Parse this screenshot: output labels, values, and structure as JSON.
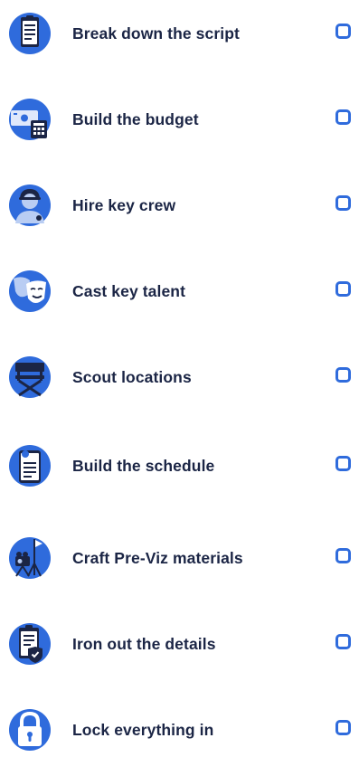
{
  "checklist": {
    "items": [
      {
        "label": "Break down the script",
        "icon": "script-clipboard-icon",
        "checked": false
      },
      {
        "label": "Build the budget",
        "icon": "budget-calculator-icon",
        "checked": false
      },
      {
        "label": "Hire key crew",
        "icon": "crew-person-icon",
        "checked": false
      },
      {
        "label": "Cast key talent",
        "icon": "theater-masks-icon",
        "checked": false
      },
      {
        "label": "Scout locations",
        "icon": "director-chair-icon",
        "checked": false
      },
      {
        "label": "Build the schedule",
        "icon": "schedule-document-icon",
        "checked": false
      },
      {
        "label": "Craft Pre-Viz materials",
        "icon": "camera-tripod-icon",
        "checked": false
      },
      {
        "label": "Iron out the details",
        "icon": "details-clipboard-shield-icon",
        "checked": false
      },
      {
        "label": "Lock everything in",
        "icon": "padlock-icon",
        "checked": false
      }
    ]
  },
  "colors": {
    "icon_circle": "#2f6bdc",
    "icon_dark": "#1b2545",
    "label_text": "#1b2545",
    "checkbox_border": "#2f6bdc"
  }
}
